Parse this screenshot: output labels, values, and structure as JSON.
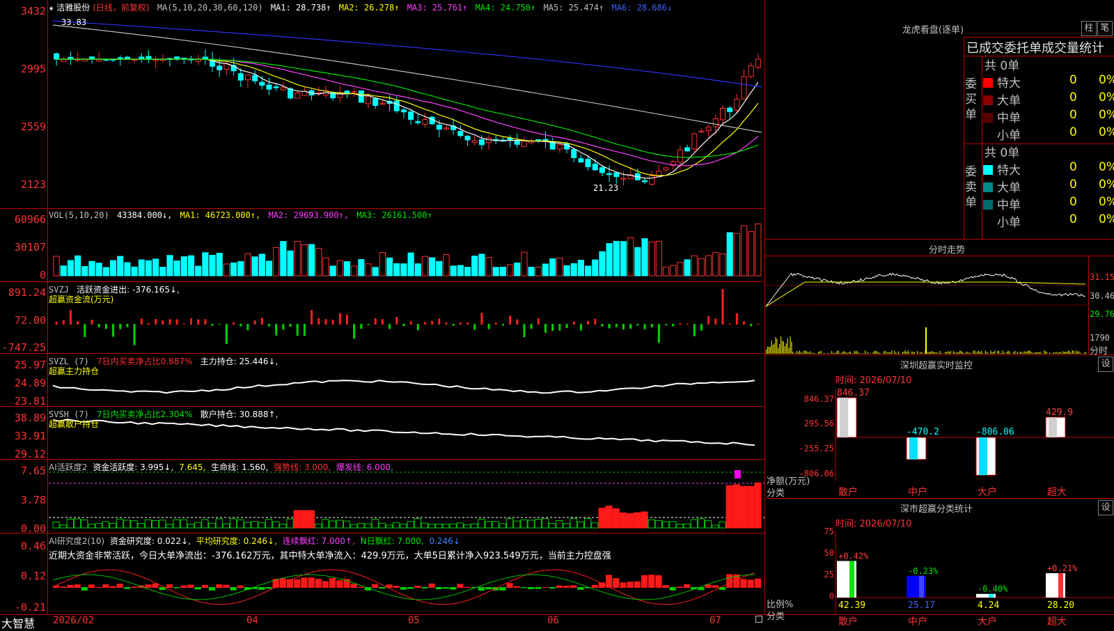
{
  "main_chart": {
    "ylabels": [
      "3432",
      "2995",
      "2559",
      "2123"
    ],
    "legend": {
      "star": "★",
      "name": "洁雅股份",
      "mode": "(日线，前复权)",
      "ma_head": "MA(5,10,20,30,60,120)",
      "ma1": "MA1: 28.738↑",
      "ma2": "MA2: 26.278↑",
      "ma3": "MA3: 25.761↑",
      "ma4": "MA4: 24.750↑",
      "ma5": "MA5: 25.474↑",
      "ma6": "MA6: 28.686↓"
    },
    "high_label": "33.83",
    "low_label": "21.23"
  },
  "vol_panel": {
    "ylabels": [
      "60966",
      "30107",
      "0"
    ],
    "legend": {
      "head": "VOL(5,10,20)",
      "value": "43384.000↓,",
      "ma1": "MA1: 46723.000↑,",
      "ma2": "MA2: 29693.900↑,",
      "ma3": "MA3: 26161.500↑"
    }
  },
  "svzj_panel": {
    "ylabels": [
      "891.24",
      "72.00",
      "-747.25"
    ],
    "legend": {
      "head": "SVZJ",
      "label": "活跃资金进出: -376.165↓,",
      "sub": "超赢资金流(万元)"
    }
  },
  "svzl_panel": {
    "ylabels": [
      "25.97",
      "24.89",
      "23.81"
    ],
    "legend": {
      "head": "SVZL (7)",
      "ratio": "7日内买卖净占比0.887%",
      "hold": "主力持仓: 25.446↓,",
      "sub": "超赢主力持仓"
    }
  },
  "svsh_panel": {
    "ylabels": [
      "38.89",
      "33.91",
      "29.12"
    ],
    "legend": {
      "head": "SVSH (7)",
      "ratio": "7日内买卖净占比2.304%",
      "hold": "散户持仓: 30.888↑,",
      "sub": "超赢散户持仓"
    }
  },
  "ai_act_panel": {
    "ylabels": [
      "7.65",
      "3.78",
      "0.00"
    ],
    "legend": {
      "head": "AI活跃度2",
      "a": "资金活跃度: 3.995↓,",
      "b": "7.645,",
      "c": "生命线: 1.560,",
      "d": "强势线: 3.000,",
      "e": "爆发线: 6.000,"
    }
  },
  "ai_res_panel": {
    "ylabels": [
      "0.46",
      "0.12",
      "-0.21"
    ],
    "legend": {
      "head": "AI研究度2(10)",
      "a": "资金研究度: 0.022↓,",
      "b": "平均研究度: 0.246↓,",
      "c": "连续飘红: 7.000↑,",
      "d": "N日飘红: 7.000,",
      "e": "0.246↓"
    },
    "comment": "近期大资金非常活跃，今日大单净流出：-376.162万元，其中特大单净流入：429.9万元，大单5日累计净入923.549万元，当前主力控盘强"
  },
  "xaxis": {
    "labels": [
      "2026/02",
      "04",
      "05",
      "06",
      "07"
    ],
    "brand": "大智慧"
  },
  "dragon_panel": {
    "title": "龙虎看盘(逐单)",
    "btn1": "柱",
    "btn2": "笔",
    "header": "已成交委托单成交量统计",
    "buy": {
      "side_label": "委买单",
      "total": "共 0单",
      "rows": [
        {
          "label": "特大",
          "count": "0",
          "pct": "0%",
          "color": "#ff0000"
        },
        {
          "label": "大单",
          "count": "0",
          "pct": "0%",
          "color": "#8b0000"
        },
        {
          "label": "中单",
          "count": "0",
          "pct": "0%",
          "color": "#5a0000"
        },
        {
          "label": "小单",
          "count": "0",
          "pct": "0%",
          "color": "#000000"
        }
      ]
    },
    "sell": {
      "side_label": "委卖单",
      "total": "共 0单",
      "rows": [
        {
          "label": "特大",
          "count": "0",
          "pct": "0%",
          "color": "#00ffff"
        },
        {
          "label": "大单",
          "count": "0",
          "pct": "0%",
          "color": "#008b8b"
        },
        {
          "label": "中单",
          "count": "0",
          "pct": "0%",
          "color": "#006b6b"
        },
        {
          "label": "小单",
          "count": "0",
          "pct": "0%",
          "color": "#000000"
        }
      ]
    }
  },
  "intraday_panel": {
    "title": "分时走势",
    "ylabels": [
      "31.15",
      "30.46",
      "29.76"
    ],
    "vol_label": "1790",
    "fen_label": "分时"
  },
  "monitor_panel": {
    "title": "深圳超赢实时监控",
    "btn": "设",
    "time": "时间: 2026/07/10",
    "ylabels": [
      "846.37",
      "295.56",
      "-255.25",
      "-806.06"
    ],
    "unit": "净额(万元)",
    "cat_label": "分类",
    "categories": [
      "散户",
      "中户",
      "大户",
      "超大"
    ],
    "values": [
      846.37,
      -470.2,
      -806.06,
      429.9
    ],
    "value_labels": [
      "846.37",
      "-470.2",
      "-806.06",
      "429.9"
    ]
  },
  "class_panel": {
    "title": "深市超赢分类统计",
    "btn": "设",
    "time": "时间: 2026/07/10",
    "ylabels": [
      "75",
      "50",
      "25",
      "0"
    ],
    "unit": "比例%",
    "cat_label": "分类",
    "categories": [
      "散户",
      "中户",
      "大户",
      "超大"
    ],
    "values": [
      42.39,
      25.17,
      4.24,
      28.2
    ],
    "top_labels": [
      "+0.42%",
      "-0.23%",
      "-0.40%",
      "+0.21%"
    ],
    "bottom_labels": [
      "42.39",
      "25.17",
      "4.24",
      "28.20"
    ]
  }
}
